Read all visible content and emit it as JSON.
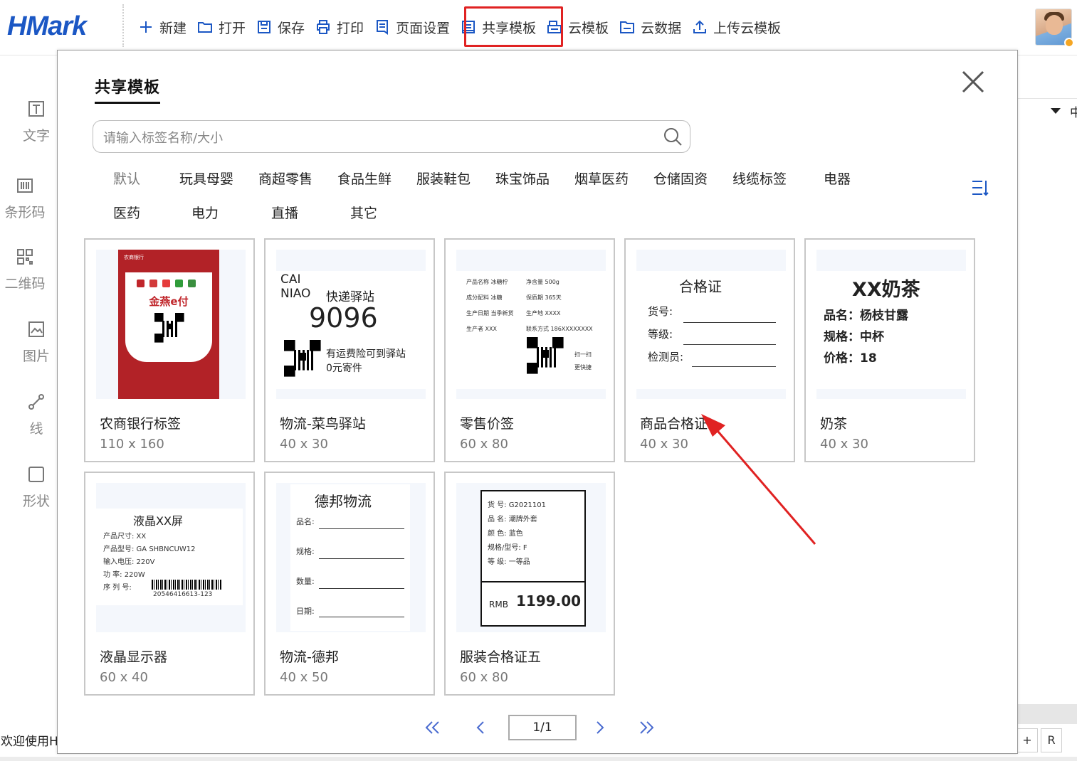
{
  "app": {
    "logo": "HMark"
  },
  "toolbar": {
    "items": [
      {
        "label": "新建",
        "icon": "plus-icon"
      },
      {
        "label": "打开",
        "icon": "folder-icon"
      },
      {
        "label": "保存",
        "icon": "save-icon"
      },
      {
        "label": "打印",
        "icon": "printer-icon"
      },
      {
        "label": "页面设置",
        "icon": "page-setup-icon"
      },
      {
        "label": "共享模板",
        "icon": "share-template-icon"
      },
      {
        "label": "云模板",
        "icon": "cloud-template-icon"
      },
      {
        "label": "云数据",
        "icon": "cloud-data-icon"
      },
      {
        "label": "上传云模板",
        "icon": "upload-icon"
      }
    ],
    "highlighted": "共享模板",
    "highlight_color": "#e02222"
  },
  "sidebar": {
    "items": [
      {
        "label": "文字",
        "icon": "text-icon"
      },
      {
        "label": "条形码",
        "icon": "barcode-icon"
      },
      {
        "label": "二维码",
        "icon": "qrcode-icon"
      },
      {
        "label": "图片",
        "icon": "image-icon"
      },
      {
        "label": "线",
        "icon": "line-icon"
      },
      {
        "label": "形状",
        "icon": "shape-icon"
      }
    ]
  },
  "status": {
    "text": "欢迎使用H"
  },
  "right_panel": {
    "glyph": "中",
    "btn_plus": "+",
    "btn_r": "R"
  },
  "modal": {
    "title": "共享模板",
    "search_placeholder": "请输入标签名称/大小",
    "categories": [
      "默认",
      "玩具母婴",
      "商超零售",
      "食品生鲜",
      "服装鞋包",
      "珠宝饰品",
      "烟草医药",
      "仓储固资",
      "线缆标签",
      "电器",
      "医药",
      "电力",
      "直播",
      "其它"
    ],
    "templates": [
      {
        "name": "农商银行标签",
        "size": "110 x 160"
      },
      {
        "name": "物流-菜鸟驿站",
        "size": "40 x 30"
      },
      {
        "name": "零售价签",
        "size": "60 x 80"
      },
      {
        "name": "商品合格证",
        "size": "40 x 30"
      },
      {
        "name": "奶茶",
        "size": "40 x 30"
      },
      {
        "name": "液晶显示器",
        "size": "60 x 40"
      },
      {
        "name": "物流-德邦",
        "size": "40 x 50"
      },
      {
        "name": "服装合格证五",
        "size": "60 x 80"
      }
    ],
    "pager": {
      "value": "1/1"
    }
  },
  "thumbs": {
    "bank": {
      "brand": "金燕e付",
      "bank_name": "农商银行"
    },
    "cainiao": {
      "l1": "CAI",
      "l2": "NIAO",
      "l3": "快递驿站",
      "code": "9096",
      "n1": "有运费险可到驿站",
      "n2": "0元寄件"
    },
    "retail": {
      "rows": [
        "产品名称 冰糖柠",
        "成分配料 冰糖",
        "生产日期 当季新货",
        "生产者 XXX"
      ],
      "rows2": [
        "净含量 500g",
        "保质期 365天",
        "生产地 XXXX",
        "联系方式 186XXXXXXXX"
      ],
      "scan": "扫一扫",
      "more": "更快捷"
    },
    "cert": {
      "title": "合格证",
      "f1": "货号:",
      "f2": "等级:",
      "f3": "检测员:"
    },
    "tea": {
      "title": "XX奶茶",
      "l1": "品名：杨枝甘露",
      "l2": "规格：中杯",
      "l3": "价格：18"
    },
    "lcd": {
      "title": "液晶XX屏",
      "l1": "产品尺寸: XX",
      "l2": "产品型号: GA SHBNCUW12",
      "l3": "输入电压: 220V",
      "l4": "功    率: 220W",
      "l5": "序 列 号:",
      "code": "20546416613-123"
    },
    "debang": {
      "title": "德邦物流",
      "f1": "品名:",
      "f2": "规格:",
      "f3": "数量:",
      "f4": "日期:"
    },
    "garment": {
      "l1": "货    号: G2021101",
      "l2": "品    名: 潮牌外套",
      "l3": "颜    色: 蓝色",
      "l4": "规格/型号: F",
      "l5": "等    级: 一等品",
      "currency": "RMB",
      "price": "1199.00"
    }
  }
}
